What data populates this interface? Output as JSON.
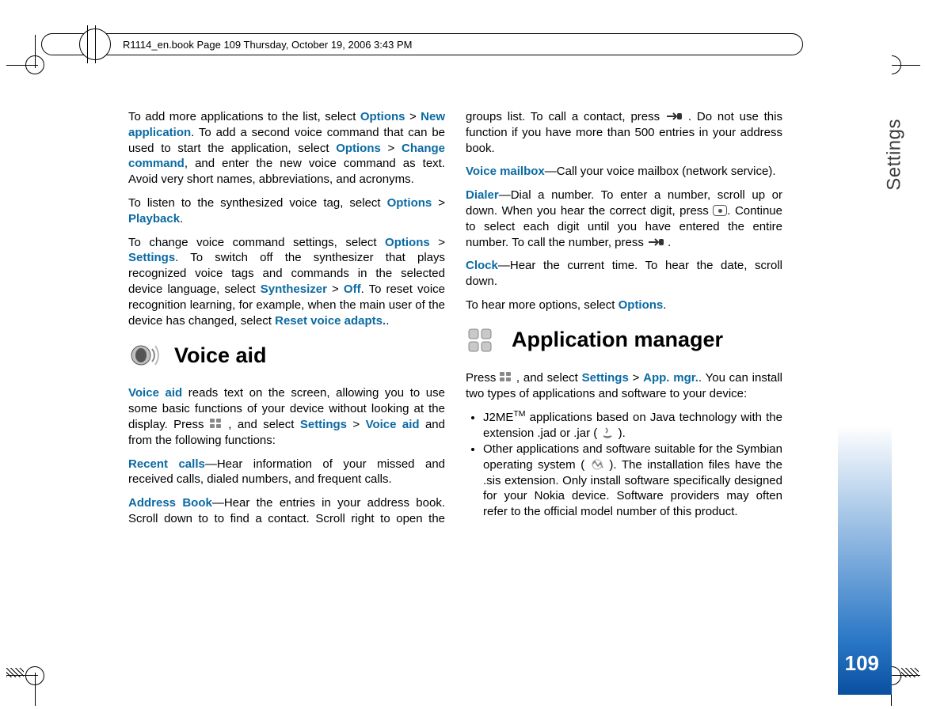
{
  "header": {
    "bookline": "R1114_en.book  Page 109  Thursday, October 19, 2006  3:43 PM"
  },
  "side": {
    "tab": "Settings",
    "page": "109"
  },
  "p": {
    "a1a": "To add more applications to the list, select ",
    "a1b": " > ",
    "a1c": ". To add a second voice command that can be used to start the application, select ",
    "a1d": " > ",
    "a1e": ", and enter the new voice command as text. Avoid very short names, abbreviations, and acronyms.",
    "a2a": "To listen to the synthesized voice tag, select ",
    "a2b": " > ",
    "a2c": ".",
    "a3a": "To change voice command settings, select ",
    "a3b": " > ",
    "a3c": ". To switch off the synthesizer that plays recognized voice tags and commands in the selected device language, select ",
    "a3d": " > ",
    "a3e": ". To reset voice recognition learning, for example, when the main user of the device has changed, select ",
    "a3f": ".",
    "va1a": "",
    "va1b": " reads text on the screen, allowing you to use some basic functions of your device without looking at the display. Press ",
    "va1c": " , and select ",
    "va1d": " > ",
    "va1e": " and from the following functions:",
    "rc": "—Hear information of your missed and received calls, dialed numbers, and frequent calls.",
    "ab1": "—Hear the entries in your address book. Scroll down to to find a contact. Scroll right to open the groups list. To call a contact, press ",
    "ab2": " . Do not use this ",
    "ab3": "function if you have more than 500 entries in your address book.",
    "vm": "—Call your voice mailbox (network service).",
    "dl1": "—Dial a number. To enter a number, scroll up or down. When you hear the correct digit, press ",
    "dl2": ". Continue to select each digit until you have entered the entire number. To call the number, press ",
    "dl3": " .",
    "ck": "—Hear the current time. To hear the date, scroll down.",
    "mo1": "To hear more options, select ",
    "mo2": ".",
    "am1": "Press ",
    "am2": " , and select ",
    "am3": " > ",
    "am4": ". You can install two types of applications and software to your device:",
    "li1a": "J2ME",
    "li1b": " applications based on Java technology with the extension .jad or .jar (",
    "li1c": " ).",
    "li2a": "Other applications and software suitable for the Symbian operating system (",
    "li2b": " ). The installation files have the .sis extension. Only install software specifically designed for your Nokia device. Software providers may often refer to the official model number of this product."
  },
  "k": {
    "options": "Options",
    "newapp": "New application",
    "changecmd": "Change command",
    "playback": "Playback",
    "settings": "Settings",
    "synth": "Synthesizer",
    "off": "Off",
    "reset": "Reset voice adapts.",
    "voiceaid": "Voice aid",
    "recentcalls": "Recent calls",
    "addressbook": "Address Book",
    "voicemailbox": "Voice mailbox",
    "dialer": "Dialer",
    "clock": "Clock",
    "appmgr": "App. mgr."
  },
  "h": {
    "voiceaid": "Voice aid",
    "appmgr": "Application manager"
  }
}
